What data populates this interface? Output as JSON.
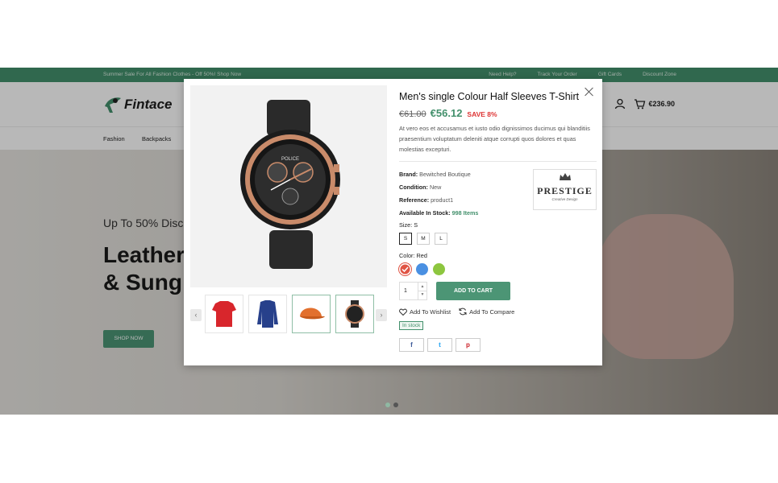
{
  "topbar": {
    "promo": "Summer Sale For All Fashion Clothes - Off 50%! Shop Now",
    "links": [
      "Need Help?",
      "Track Your Order",
      "Gift Cards",
      "Discount Zone"
    ]
  },
  "header": {
    "logo_text": "Fintace",
    "cart_total": "€236.90",
    "cart_count": "0"
  },
  "nav": {
    "items": [
      "Fashion",
      "Backpacks"
    ]
  },
  "hero": {
    "subtitle": "Up To 50% Disc",
    "title_line1": "Leather",
    "title_line2": "& Sung",
    "button": "SHOP NOW"
  },
  "modal": {
    "title": "Men's single Colour Half Sleeves T-Shirt",
    "old_price": "€61.00",
    "new_price": "€56.12",
    "save": "SAVE 8%",
    "description": "At vero eos et accusamus et iusto odio dignissimos ducimus qui blanditiis praesentium voluptatum deleniti atque corrupti quos dolores et quas molestias excepturi.",
    "brand_label": "Brand:",
    "brand_value": "Bewitched Boutique",
    "condition_label": "Condition:",
    "condition_value": "New",
    "reference_label": "Reference:",
    "reference_value": "product1",
    "stock_label": "Available In Stock:",
    "stock_value": "998 Items",
    "brand_logo_text": "PRESTIGE",
    "brand_logo_sub": "Creative Design",
    "size_label": "Size: S",
    "sizes": [
      "S",
      "M",
      "L"
    ],
    "color_label": "Color: Red",
    "colors": [
      "#e05444",
      "#4a90e2",
      "#8dc63f"
    ],
    "quantity": "1",
    "add_to_cart": "ADD TO CART",
    "wishlist": "Add To Wishlist",
    "compare": "Add To Compare",
    "in_stock": "In stock",
    "share": [
      "f",
      "t",
      "p"
    ],
    "watch_brand": "POLICE"
  }
}
